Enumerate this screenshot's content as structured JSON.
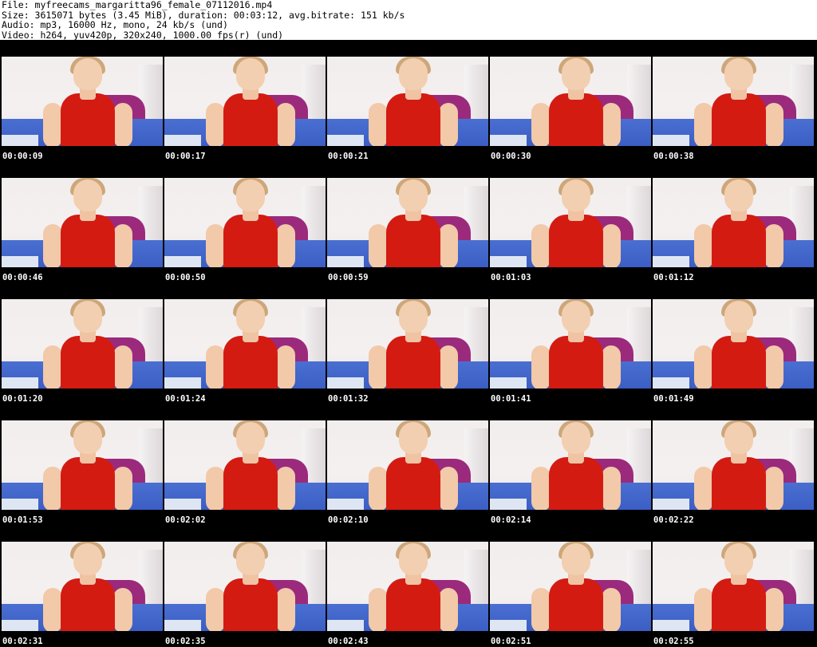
{
  "header": {
    "line1": "File: myfreecams_margaritta96_female_07112016.mp4",
    "line2": "Size: 3615071 bytes (3.45 MiB), duration: 00:03:12, avg.bitrate: 151 kb/s",
    "line3": "Audio: mp3, 16000 Hz, mono, 24 kb/s (und)",
    "line4": "Video: h264, yuv420p, 320x240, 1000.00 fps(r) (und)"
  },
  "thumbnails": [
    "00:00:09",
    "00:00:17",
    "00:00:21",
    "00:00:30",
    "00:00:38",
    "00:00:46",
    "00:00:50",
    "00:00:59",
    "00:01:03",
    "00:01:12",
    "00:01:20",
    "00:01:24",
    "00:01:32",
    "00:01:41",
    "00:01:49",
    "00:01:53",
    "00:02:02",
    "00:02:10",
    "00:02:14",
    "00:02:22",
    "00:02:31",
    "00:02:35",
    "00:02:43",
    "00:02:51",
    "00:02:55"
  ],
  "colors": {
    "background": "#000000",
    "timestamp": "#ffffff",
    "dress": "#d41b12",
    "blanket": "#4a6fd1",
    "pillow": "#9b2a7c"
  }
}
